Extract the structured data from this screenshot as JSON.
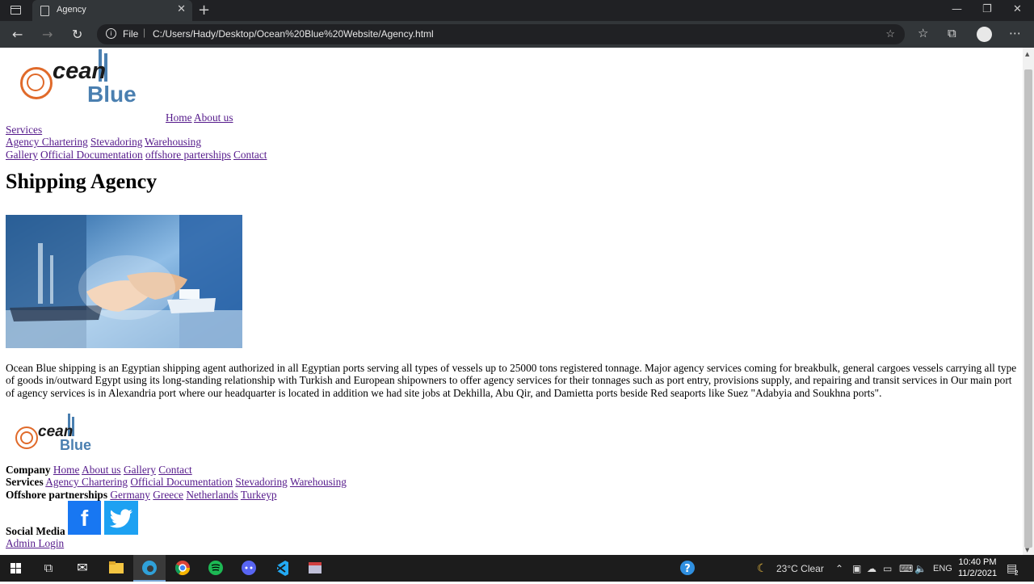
{
  "browser": {
    "tab_title": "Agency",
    "url_scheme": "File",
    "url": "C:/Users/Hady/Desktop/Ocean%20Blue%20Website/Agency.html"
  },
  "header": {
    "logo_word1": "cean",
    "logo_word2": "Blue",
    "nav": [
      "Home",
      "About us",
      "Services",
      "Agency Chartering",
      "Stevadoring",
      "Warehousing",
      "Gallery",
      "Official Documentation",
      "offshore parterships",
      "Contact"
    ]
  },
  "main": {
    "title": "Shipping Agency",
    "description": "Ocean Blue shipping is an Egyptian shipping agent authorized in all Egyptian ports serving all types of vessels up to 25000 tons registered tonnage. Major agency services coming for breakbulk, general cargoes vessels carrying all type of goods in/outward Egypt using its long-standing relationship with Turkish and European shipowners to offer agency services for their tonnages such as port entry, provisions supply, and repairing and transit services in Our main port of agency services is in Alexandria port where our headquarter is located in addition we had site jobs at Dekhilla, Abu Qir, and Damietta ports beside Red seaports like Suez \"Adabyia and Soukhna ports\"."
  },
  "footer": {
    "company_label": "Company",
    "company_links": [
      "Home",
      "About us",
      "Gallery",
      "Contact"
    ],
    "services_label": "Services",
    "services_links": [
      "Agency Chartering",
      "Official Documentation",
      "Stevadoring",
      "Warehousing"
    ],
    "offshore_label": "Offshore partnerships",
    "offshore_links": [
      "Germany",
      "Greece",
      "Netherlands",
      "Turkeyp"
    ],
    "social_label": "Social Media",
    "admin_login": "Admin Login"
  },
  "taskbar": {
    "weather": "23°C  Clear",
    "language": "ENG",
    "time": "10:40 PM",
    "date": "11/2/2021",
    "notifications": "2"
  },
  "colors": {
    "link": "#551a8b",
    "facebook": "#1877f2",
    "twitter": "#1da1f2",
    "logo_orange": "#e06a2a",
    "logo_blue": "#4a7fb0"
  }
}
